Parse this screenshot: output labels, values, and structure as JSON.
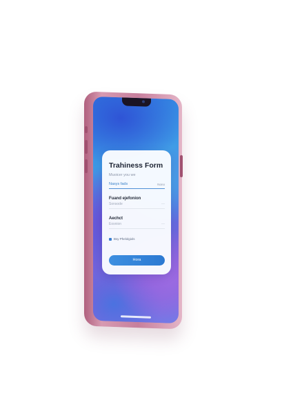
{
  "form": {
    "title": "Trahiness Form",
    "subtitle": "Muoicer you we",
    "field1": {
      "value": "Nasys fads",
      "hint": "Nono"
    },
    "field2": {
      "label": "Fuand ejefonion",
      "placeholder": "Sonsode",
      "trailing": "—"
    },
    "field3": {
      "label": "Aechct",
      "placeholder": "Eosnion",
      "trailing": "—"
    },
    "checkbox_label": "Bsy Phelolgiols",
    "submit_label": "Hora"
  },
  "colors": {
    "accent": "#3b82c9",
    "phone_frame": "#c77f9d",
    "card_bg": "#fafcff"
  }
}
